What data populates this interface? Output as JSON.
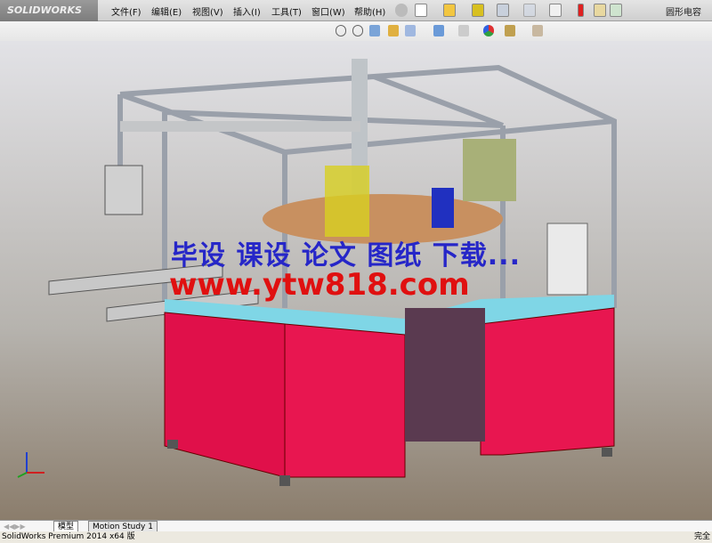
{
  "app": {
    "logo": "SOLIDWORKS",
    "title": "圆形电容",
    "brand_color": "#c8102e"
  },
  "menu": [
    {
      "label": "文件(F)"
    },
    {
      "label": "编辑(E)"
    },
    {
      "label": "视图(V)"
    },
    {
      "label": "插入(I)"
    },
    {
      "label": "工具(T)"
    },
    {
      "label": "窗口(W)"
    },
    {
      "label": "帮助(H)"
    }
  ],
  "toolbar_icons": [
    "pin-icon",
    "new-document-icon",
    "open-icon",
    "save-icon",
    "print-icon",
    "undo-icon",
    "select-icon",
    "rebuild-icon",
    "options-icon",
    "file-properties-icon"
  ],
  "view_toolbar_icons": [
    "zoom-to-fit-icon",
    "zoom-area-icon",
    "previous-view-icon",
    "section-view-icon",
    "view-orientation-icon",
    "display-style-icon",
    "hide-show-icon",
    "edit-appearance-icon",
    "apply-scene-icon",
    "view-settings-icon"
  ],
  "watermark": {
    "line1": "毕设 课设 论文 图纸 下载...",
    "line2": "www.ytw818.com"
  },
  "tabs": [
    {
      "label": "模型",
      "active": true
    },
    {
      "label": "Motion Study 1",
      "active": false
    }
  ],
  "status": {
    "left": "SolidWorks Premium 2014 x64 版",
    "right": "完全"
  }
}
